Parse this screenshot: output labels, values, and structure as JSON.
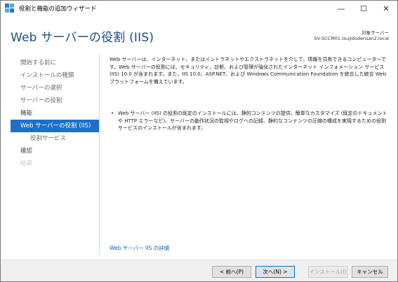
{
  "window": {
    "title": "役割と機能の追加ウィザード",
    "controls": {
      "minimize": "—",
      "maximize": "☐",
      "close": "✕"
    }
  },
  "header": {
    "page_title": "Web サーバーの役割 (IIS)",
    "target_label": "対象サーバー",
    "target_server": "SV-SCCM01.tsujidodensan2.local"
  },
  "nav": {
    "items": [
      {
        "label": "開始する前に",
        "state": "normal"
      },
      {
        "label": "インストールの種類",
        "state": "normal"
      },
      {
        "label": "サーバーの選択",
        "state": "normal"
      },
      {
        "label": "サーバーの役割",
        "state": "normal"
      },
      {
        "label": "機能",
        "state": "dark"
      },
      {
        "label": "Web サーバーの役割 (IIS)",
        "state": "active"
      },
      {
        "label": "役割サービス",
        "state": "sub"
      },
      {
        "label": "確認",
        "state": "dark"
      },
      {
        "label": "結果",
        "state": "disabled"
      }
    ]
  },
  "content": {
    "intro": "Web サーバーは、インターネット、またはイントラネットやエクストラネットを介して、情報を共有できるコンピューターです。Web サーバーの役割には、セキュリティ、診断、および管理が強化されたインターネット インフォメーション サービス (IIS) 10.0 が含まれます。また、IIS 10.0、ASP.NET、および Windows Communication Foundation を統合した統合 Web プラットフォームを備えています。",
    "bullet": "Web サーバー (IIS) の役割の既定のインストールには、静的コンテンツの提供、簡単なカスタマイズ (既定のドキュメントや HTTP エラーなど)、サーバーの動作状況の監視やログへの記録、静的なコンテンツの圧縮の構成を実現するための役割サービスのインストールが含まれます。",
    "bullet_symbol": "•",
    "link": "Web サーバー IIS の詳細"
  },
  "footer": {
    "prev": "< 前へ(P)",
    "next": "次へ(N) >",
    "install": "インストール(I)",
    "cancel": "キャンセル"
  },
  "colors": {
    "accent": "#1e6fc8",
    "title": "#1f4e79",
    "link": "#1a5fb4"
  }
}
